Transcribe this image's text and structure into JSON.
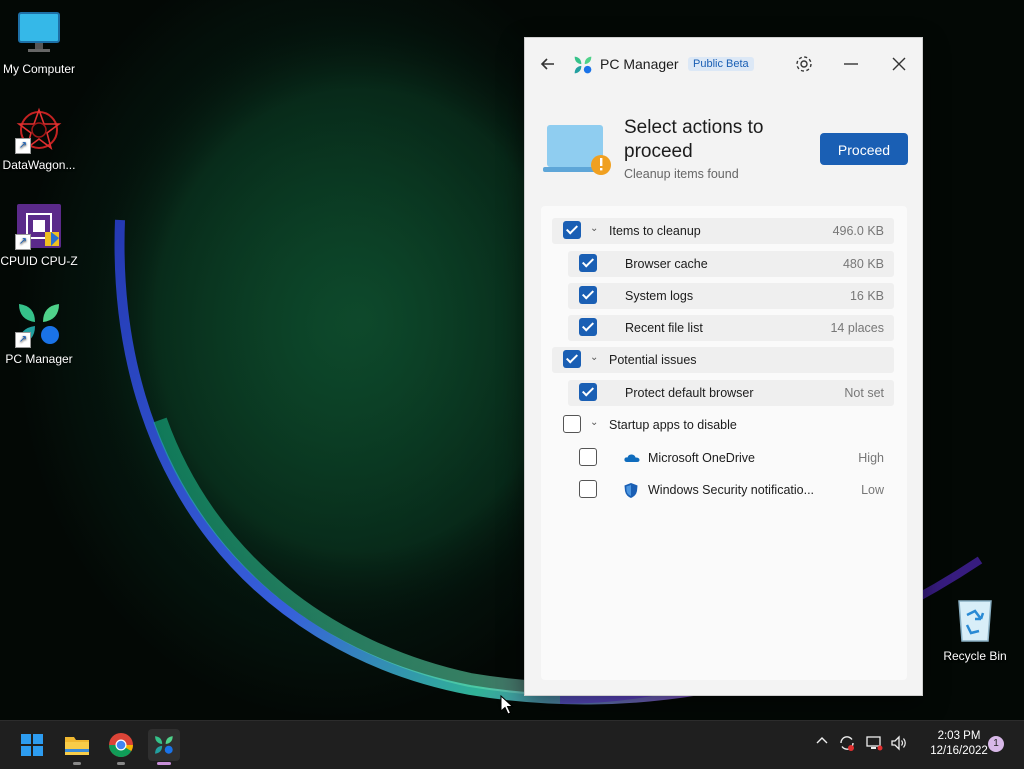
{
  "desktop": {
    "icons": [
      {
        "label": "My Computer"
      },
      {
        "label": "DataWagon..."
      },
      {
        "label": "CPUID CPU-Z"
      },
      {
        "label": "PC Manager"
      },
      {
        "label": "Recycle Bin"
      }
    ]
  },
  "window": {
    "app_name": "PC Manager",
    "badge": "Public Beta",
    "hero": {
      "title": "Select actions to proceed",
      "subtitle": "Cleanup items found",
      "proceed_label": "Proceed"
    },
    "groups": [
      {
        "label": "Items to cleanup",
        "value": "496.0 KB",
        "checked": true,
        "items": [
          {
            "label": "Browser cache",
            "value": "480 KB",
            "checked": true
          },
          {
            "label": "System logs",
            "value": "16 KB",
            "checked": true
          },
          {
            "label": "Recent file list",
            "value": "14 places",
            "checked": true
          }
        ]
      },
      {
        "label": "Potential issues",
        "value": "",
        "checked": true,
        "items": [
          {
            "label": "Protect default browser",
            "value": "Not set",
            "checked": true
          }
        ]
      },
      {
        "label": "Startup apps to disable",
        "value": "",
        "checked": false,
        "items": [
          {
            "label": "Microsoft OneDrive",
            "value": "High",
            "checked": false,
            "icon": "onedrive-icon"
          },
          {
            "label": "Windows Security notificatio...",
            "value": "Low",
            "checked": false,
            "icon": "windows-security-icon"
          }
        ]
      }
    ]
  },
  "taskbar": {
    "time": "2:03 PM",
    "date": "12/16/2022",
    "notification_count": "1"
  },
  "colors": {
    "accent": "#1a5fb4"
  }
}
